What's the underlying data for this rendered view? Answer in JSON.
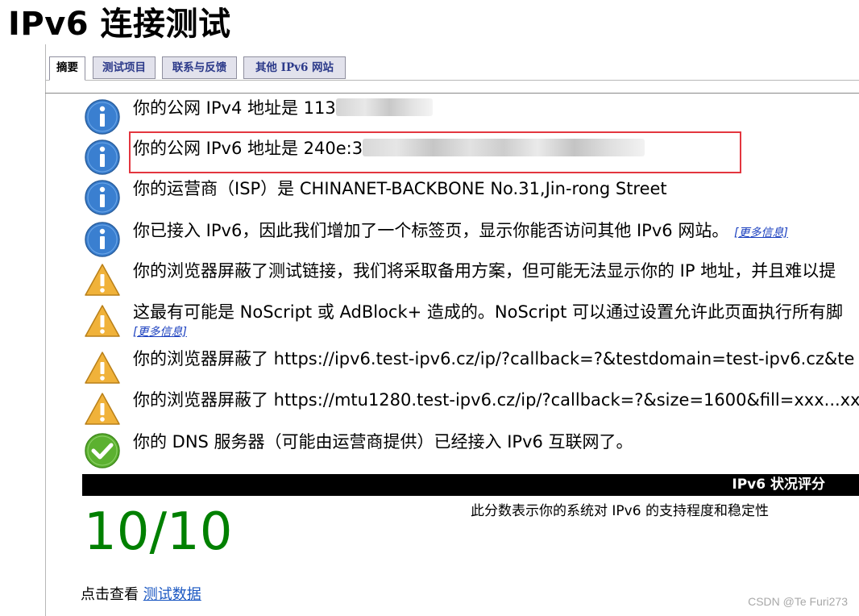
{
  "page": {
    "title": "IPv6 连接测试"
  },
  "tabs": [
    {
      "label": "摘要",
      "active": true
    },
    {
      "label": "测试项目",
      "active": false
    },
    {
      "label": "联系与反馈",
      "active": false
    },
    {
      "label": "其他 IPv6 网站",
      "active": false
    }
  ],
  "messages": [
    {
      "icon": "info-icon",
      "text": "你的公网 IPv4 地址是 113"
    },
    {
      "icon": "info-icon",
      "text": "你的公网 IPv6 地址是 240e:3"
    },
    {
      "icon": "info-icon",
      "text": "你的运营商（ISP）是 CHINANET-BACKBONE No.31,Jin-rong Street"
    },
    {
      "icon": "info-icon",
      "text": "你已接入 IPv6，因此我们增加了一个标签页，显示你能否访问其他 IPv6 网站。",
      "link": "[更多信息]"
    },
    {
      "icon": "warning-icon",
      "text": "你的浏览器屏蔽了测试链接，我们将采取备用方案，但可能无法显示你的 IP 地址，并且难以提"
    },
    {
      "icon": "warning-icon",
      "text": "这最有可能是 NoScript 或 AdBlock+ 造成的。NoScript 可以通过设置允许此页面执行所有脚",
      "link": "[更多信息]"
    },
    {
      "icon": "warning-icon",
      "text": "你的浏览器屏蔽了 https://ipv6.test-ipv6.cz/ip/?callback=?&testdomain=test-ipv6.cz&te"
    },
    {
      "icon": "warning-icon",
      "text": "你的浏览器屏蔽了 https://mtu1280.test-ipv6.cz/ip/?callback=?&size=1600&fill=xxx...xxx"
    },
    {
      "icon": "check-icon",
      "text": "你的 DNS 服务器（可能由运营商提供）已经接入 IPv6 互联网了。"
    }
  ],
  "score": {
    "header": "IPv6 状况评分",
    "value": "10/10",
    "description": "此分数表示你的系统对 IPv6 的支持程度和稳定性"
  },
  "footer": {
    "prefix": "点击查看",
    "link": "测试数据"
  },
  "watermark": "CSDN @Te   Furi273",
  "colors": {
    "info": "#3a7fd0",
    "warning": "#f0b23a",
    "check": "#5cb130",
    "score": "#008000",
    "highlight": "#e3363f"
  }
}
